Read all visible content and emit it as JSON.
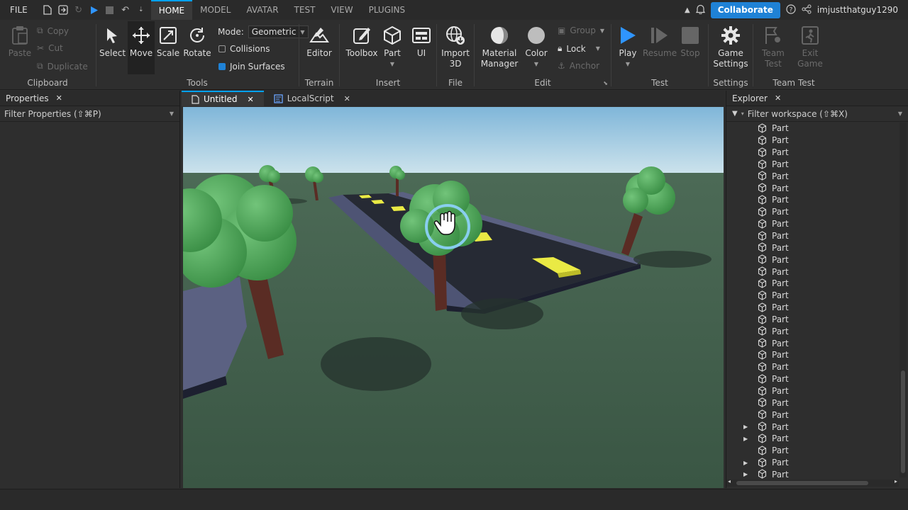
{
  "menubar": {
    "file": "FILE",
    "tabs": [
      "HOME",
      "MODEL",
      "AVATAR",
      "TEST",
      "VIEW",
      "PLUGINS"
    ],
    "collaborate": "Collaborate",
    "username": "imjustthatguy1290"
  },
  "ribbon": {
    "clipboard": {
      "paste": "Paste",
      "copy": "Copy",
      "cut": "Cut",
      "duplicate": "Duplicate",
      "label": "Clipboard"
    },
    "tools": {
      "select": "Select",
      "move": "Move",
      "scale": "Scale",
      "rotate": "Rotate",
      "mode_label": "Mode:",
      "mode_value": "Geometric",
      "collisions": "Collisions",
      "join_surfaces": "Join Surfaces",
      "label": "Tools"
    },
    "terrain": {
      "editor": "Editor",
      "label": "Terrain"
    },
    "insert": {
      "toolbox": "Toolbox",
      "part": "Part",
      "ui": "UI",
      "label": "Insert"
    },
    "file": {
      "import3d_line1": "Import",
      "import3d_line2": "3D",
      "label": "File"
    },
    "edit": {
      "material_line1": "Material",
      "material_line2": "Manager",
      "color": "Color",
      "group": "Group",
      "lock": "Lock",
      "anchor": "Anchor",
      "label": "Edit"
    },
    "test": {
      "play": "Play",
      "resume": "Resume",
      "stop": "Stop",
      "label": "Test"
    },
    "settings": {
      "game_line1": "Game",
      "game_line2": "Settings",
      "label": "Settings"
    },
    "teamtest": {
      "team_line1": "Team",
      "team_line2": "Test",
      "exit_line1": "Exit",
      "exit_line2": "Game",
      "label": "Team Test"
    }
  },
  "properties": {
    "title": "Properties",
    "filter": "Filter Properties (⇧⌘P)"
  },
  "doc_tabs": [
    {
      "label": "Untitled"
    },
    {
      "label": "LocalScript"
    }
  ],
  "explorer": {
    "title": "Explorer",
    "filter": "Filter workspace (⇧⌘X)",
    "items": [
      {
        "label": "Part"
      },
      {
        "label": "Part"
      },
      {
        "label": "Part"
      },
      {
        "label": "Part"
      },
      {
        "label": "Part"
      },
      {
        "label": "Part"
      },
      {
        "label": "Part"
      },
      {
        "label": "Part"
      },
      {
        "label": "Part"
      },
      {
        "label": "Part"
      },
      {
        "label": "Part"
      },
      {
        "label": "Part"
      },
      {
        "label": "Part"
      },
      {
        "label": "Part"
      },
      {
        "label": "Part"
      },
      {
        "label": "Part"
      },
      {
        "label": "Part"
      },
      {
        "label": "Part"
      },
      {
        "label": "Part"
      },
      {
        "label": "Part"
      },
      {
        "label": "Part"
      },
      {
        "label": "Part"
      },
      {
        "label": "Part"
      },
      {
        "label": "Part"
      },
      {
        "label": "Part"
      },
      {
        "label": "Part"
      },
      {
        "label": "Part"
      },
      {
        "label": "Part"
      },
      {
        "label": "Part"
      },
      {
        "label": "Part"
      }
    ],
    "expanded_rows": [
      25,
      26,
      28,
      29
    ]
  },
  "colors": {
    "accent": "#00a2ff",
    "collab": "#1f82d6",
    "play": "#2f95ff",
    "grass": "#3c5a45",
    "sky": "#86bfe0",
    "road": "#4a4f6e",
    "tree": "#46a050",
    "trunk": "#5a2c24",
    "marking": "#f0f040"
  }
}
